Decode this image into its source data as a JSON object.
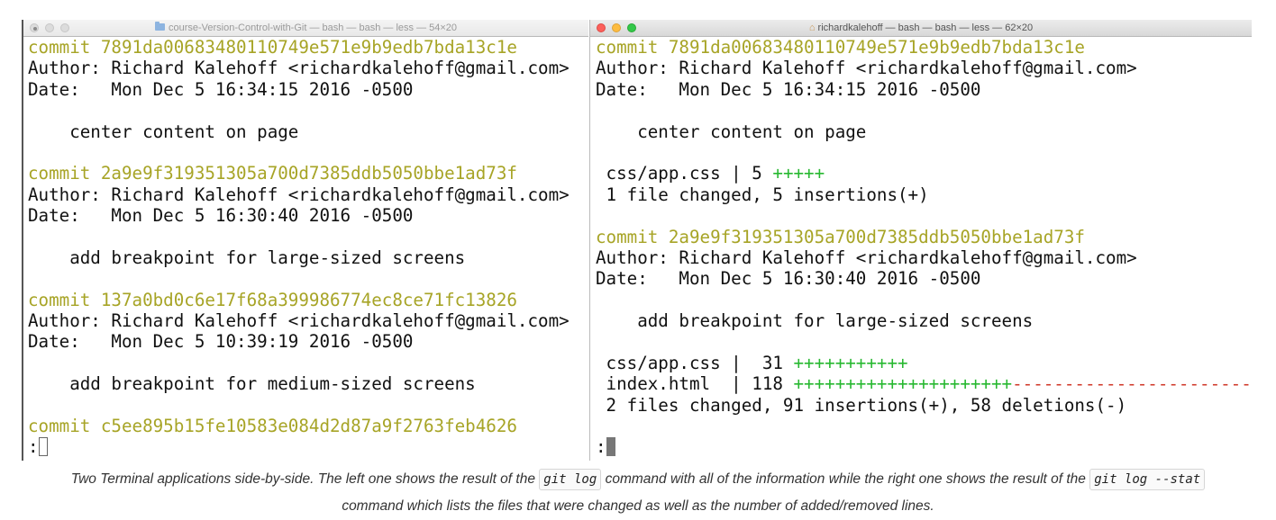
{
  "left_window": {
    "title": "course-Version-Control-with-Git — bash — bash — less — 54×20",
    "lines": [
      {
        "type": "hash",
        "text": "commit 7891da00683480110749e571e9b9edb7bda13c1e"
      },
      {
        "type": "text",
        "text": "Author: Richard Kalehoff <richardkalehoff@gmail.com>"
      },
      {
        "type": "text",
        "text": "Date:   Mon Dec 5 16:34:15 2016 -0500"
      },
      {
        "type": "text",
        "text": ""
      },
      {
        "type": "text",
        "text": "    center content on page"
      },
      {
        "type": "text",
        "text": ""
      },
      {
        "type": "hash",
        "text": "commit 2a9e9f319351305a700d7385ddb5050bbe1ad73f"
      },
      {
        "type": "text",
        "text": "Author: Richard Kalehoff <richardkalehoff@gmail.com>"
      },
      {
        "type": "text",
        "text": "Date:   Mon Dec 5 16:30:40 2016 -0500"
      },
      {
        "type": "text",
        "text": ""
      },
      {
        "type": "text",
        "text": "    add breakpoint for large-sized screens"
      },
      {
        "type": "text",
        "text": ""
      },
      {
        "type": "hash",
        "text": "commit 137a0bd0c6e17f68a399986774ec8ce71fc13826"
      },
      {
        "type": "text",
        "text": "Author: Richard Kalehoff <richardkalehoff@gmail.com>"
      },
      {
        "type": "text",
        "text": "Date:   Mon Dec 5 10:39:19 2016 -0500"
      },
      {
        "type": "text",
        "text": ""
      },
      {
        "type": "text",
        "text": "    add breakpoint for medium-sized screens"
      },
      {
        "type": "text",
        "text": ""
      },
      {
        "type": "hash",
        "text": "commit c5ee895b15fe10583e084d2d87a9f2763feb4626"
      }
    ],
    "prompt": ":"
  },
  "right_window": {
    "title": "richardkalehoff — bash — bash — less — 62×20",
    "lines": [
      {
        "type": "hash",
        "text": "commit 7891da00683480110749e571e9b9edb7bda13c1e"
      },
      {
        "type": "text",
        "text": "Author: Richard Kalehoff <richardkalehoff@gmail.com>"
      },
      {
        "type": "text",
        "text": "Date:   Mon Dec 5 16:34:15 2016 -0500"
      },
      {
        "type": "text",
        "text": ""
      },
      {
        "type": "text",
        "text": "    center content on page"
      },
      {
        "type": "text",
        "text": ""
      },
      {
        "type": "stat",
        "text": " css/app.css | 5 ",
        "plus": "+++++",
        "minus": ""
      },
      {
        "type": "text",
        "text": " 1 file changed, 5 insertions(+)"
      },
      {
        "type": "text",
        "text": ""
      },
      {
        "type": "hash",
        "text": "commit 2a9e9f319351305a700d7385ddb5050bbe1ad73f"
      },
      {
        "type": "text",
        "text": "Author: Richard Kalehoff <richardkalehoff@gmail.com>"
      },
      {
        "type": "text",
        "text": "Date:   Mon Dec 5 16:30:40 2016 -0500"
      },
      {
        "type": "text",
        "text": ""
      },
      {
        "type": "text",
        "text": "    add breakpoint for large-sized screens"
      },
      {
        "type": "text",
        "text": ""
      },
      {
        "type": "stat",
        "text": " css/app.css |  31 ",
        "plus": "+++++++++++",
        "minus": ""
      },
      {
        "type": "stat",
        "text": " index.html  | 118 ",
        "plus": "+++++++++++++++++++++",
        "minus": "--------------------------"
      },
      {
        "type": "text",
        "text": " 2 files changed, 91 insertions(+), 58 deletions(-)"
      },
      {
        "type": "text",
        "text": ""
      }
    ],
    "prompt": ":"
  },
  "caption": {
    "part1": "Two Terminal applications side-by-side. The left one shows the result of the ",
    "code1": "git log",
    "part2": " command with all of the information while the right one shows the result of the ",
    "code2": "git log --stat",
    "part3": " command which lists the files that were changed as well as the number of added/removed lines."
  },
  "colors": {
    "hash": "#a7a426",
    "plus": "#27b830",
    "minus": "#d03a2a"
  }
}
